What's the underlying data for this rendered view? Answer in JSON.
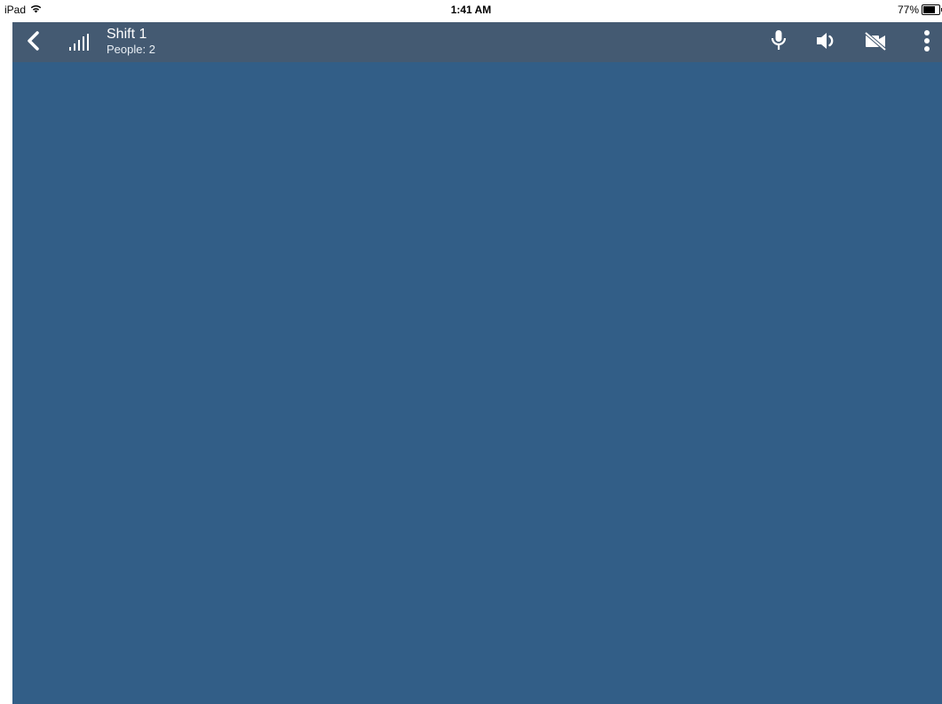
{
  "status_bar": {
    "device": "iPad",
    "time": "1:41 AM",
    "battery": "77%",
    "battery_level": 0.77,
    "wifi_icon": "wifi-icon",
    "battery_icon": "battery-icon"
  },
  "header": {
    "title": "Shift 1",
    "subtitle": "People: 2",
    "background": "#445a72",
    "icons": {
      "back": "chevron-left-icon",
      "signal": "signal-strength-icon",
      "mic": "microphone-icon",
      "speaker": "speaker-icon",
      "video": "video-off-icon",
      "more": "more-vertical-icon"
    }
  },
  "main": {
    "background": "#325e87"
  }
}
